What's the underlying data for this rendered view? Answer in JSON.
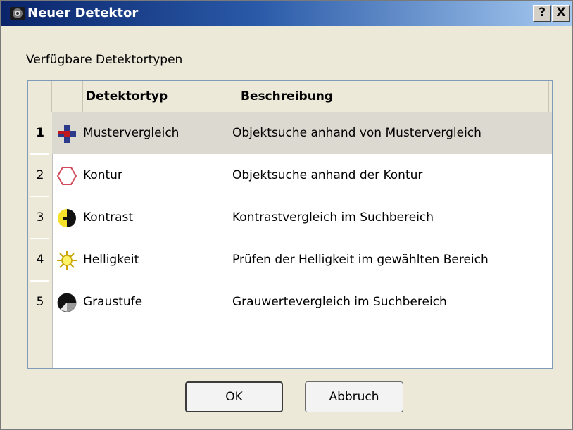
{
  "window": {
    "title": "Neuer Detektor",
    "help_label": "?",
    "close_label": "X"
  },
  "section_label": "Verfügbare Detektortypen",
  "table": {
    "columns": [
      "Detektortyp",
      "Beschreibung"
    ],
    "rows": [
      {
        "num": "1",
        "icon": "pattern-cross-icon",
        "type": "Mustervergleich",
        "description": "Objektsuche anhand von Mustervergleich",
        "selected": true
      },
      {
        "num": "2",
        "icon": "hexagon-outline-icon",
        "type": "Kontur",
        "description": "Objektsuche anhand der Kontur"
      },
      {
        "num": "3",
        "icon": "contrast-half-circle-icon",
        "type": "Kontrast",
        "description": "Kontrastvergleich im Suchbereich"
      },
      {
        "num": "4",
        "icon": "sun-brightness-icon",
        "type": "Helligkeit",
        "description": "Prüfen der Helligkeit im gewählten Bereich"
      },
      {
        "num": "5",
        "icon": "grayscale-circle-icon",
        "type": "Graustufe",
        "description": "Grauwertevergleich im Suchbereich"
      }
    ]
  },
  "buttons": {
    "ok": "OK",
    "cancel": "Abbruch"
  }
}
